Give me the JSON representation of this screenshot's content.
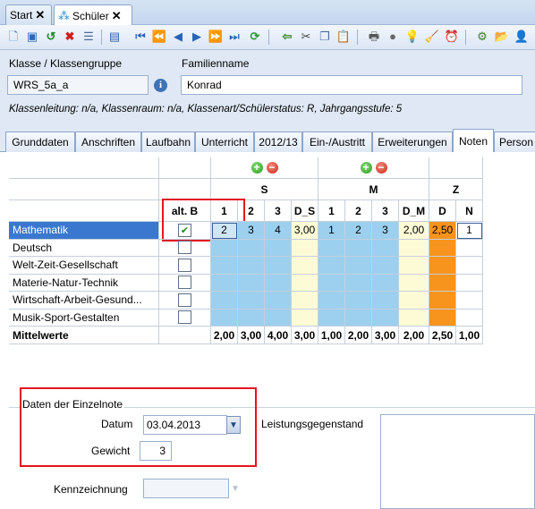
{
  "doc_tabs": [
    {
      "label": "Start"
    },
    {
      "label": "Schüler"
    }
  ],
  "colors": {
    "accent": "#2b6cc4",
    "selected_row": "#3a78cf",
    "blue_cell": "#9cd0ee",
    "yellow_cell": "#fdfbd6",
    "orange_cell": "#f7941d",
    "highlight": "#e3161c"
  },
  "form": {
    "klasse_label": "Klasse / Klassengruppe",
    "klasse_value": "WRS_5a_a",
    "familienname_label": "Familienname",
    "familienname_value": "Konrad",
    "info_line": "Klassenleitung: n/a, Klassenraum: n/a, Klassenart/Schülerstatus: R, Jahrgangsstufe: 5"
  },
  "reg_tabs": [
    "Grunddaten",
    "Anschriften",
    "Laufbahn",
    "Unterricht",
    "2012/13",
    "Ein-/Austritt",
    "Erweiterungen",
    "Noten",
    "Person"
  ],
  "active_reg_tab": "Noten",
  "grid": {
    "alt_b_header": "alt. B",
    "groups": [
      "S",
      "M",
      "Z"
    ],
    "sub_headers": [
      "1",
      "2",
      "3",
      "D_S",
      "1",
      "2",
      "3",
      "D_M",
      "D",
      "N"
    ],
    "rows": [
      {
        "subject": "Mathematik",
        "checked": true,
        "values": [
          "2",
          "3",
          "4",
          "3,00",
          "1",
          "2",
          "3",
          "2,00",
          "2,50",
          "1"
        ]
      },
      {
        "subject": "Deutsch",
        "checked": false,
        "values": [
          "",
          "",
          "",
          "",
          "",
          "",
          "",
          "",
          "",
          ""
        ]
      },
      {
        "subject": "Welt-Zeit-Gesellschaft",
        "checked": false,
        "values": [
          "",
          "",
          "",
          "",
          "",
          "",
          "",
          "",
          "",
          ""
        ]
      },
      {
        "subject": "Materie-Natur-Technik",
        "checked": false,
        "values": [
          "",
          "",
          "",
          "",
          "",
          "",
          "",
          "",
          "",
          ""
        ]
      },
      {
        "subject": "Wirtschaft-Arbeit-Gesund...",
        "checked": false,
        "values": [
          "",
          "",
          "",
          "",
          "",
          "",
          "",
          "",
          "",
          ""
        ]
      },
      {
        "subject": "Musik-Sport-Gestalten",
        "checked": false,
        "values": [
          "",
          "",
          "",
          "",
          "",
          "",
          "",
          "",
          "",
          ""
        ]
      }
    ],
    "mittelwerte_label": "Mittelwerte",
    "mittelwerte": [
      "2,00",
      "3,00",
      "4,00",
      "3,00",
      "1,00",
      "2,00",
      "3,00",
      "2,00",
      "2,50",
      "1,00"
    ]
  },
  "detail": {
    "legend": "Daten der Einzelnote",
    "datum_label": "Datum",
    "datum_value": "03.04.2013",
    "gewicht_label": "Gewicht",
    "gewicht_value": "3",
    "leistungsgegenstand_label": "Leistungsgegenstand",
    "kennzeichnung_label": "Kennzeichnung"
  }
}
